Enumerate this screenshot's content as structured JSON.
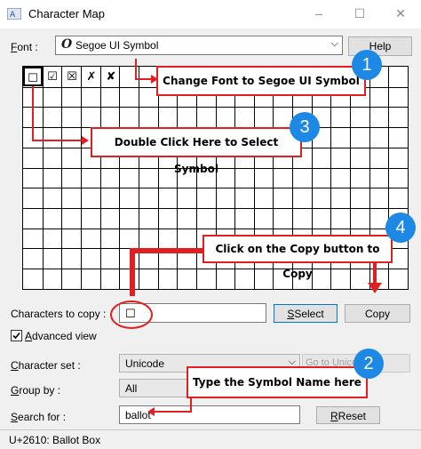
{
  "window": {
    "title": "Character Map",
    "minimize": "–",
    "maximize": "☐",
    "close": "✕"
  },
  "font": {
    "label_first": "F",
    "label_rest": "ont :",
    "glyph": "O",
    "value": "Segoe UI Symbol",
    "chevron": "⌵"
  },
  "help_label": "Help",
  "grid": {
    "cells": [
      "☐",
      "☑",
      "☒",
      "✗",
      "✘"
    ]
  },
  "copy_row": {
    "label": "Characters to copy :",
    "value": "☐",
    "select_label": "Select",
    "copy_label": "Copy"
  },
  "advanced": {
    "checked": true,
    "label_first": "A",
    "label_rest": "dvanced view"
  },
  "charset": {
    "label_first": "",
    "label_u": "C",
    "label_rest": "haracter set :",
    "value": "Unicode",
    "goto_label": "Go to Unicode"
  },
  "groupby": {
    "label_first": "",
    "label_u": "G",
    "label_rest": "roup by :",
    "value": "All"
  },
  "search": {
    "label_first": "",
    "label_u": "S",
    "label_rest": "earch for :",
    "value": "ballot",
    "reset_label": "Reset"
  },
  "status_text": "U+2610: Ballot Box",
  "annotations": {
    "a1": {
      "number": "1",
      "text": "Change Font to Segoe UI Symbol"
    },
    "a2": {
      "number": "2",
      "text": "Type the Symbol Name here"
    },
    "a3": {
      "number": "3",
      "text": "Double Click Here to Select Symbol"
    },
    "a4": {
      "number": "4",
      "text": "Click on the Copy button to Copy"
    }
  },
  "colors": {
    "annotation_red": "#e02020",
    "badge_blue": "#1e88e5"
  }
}
